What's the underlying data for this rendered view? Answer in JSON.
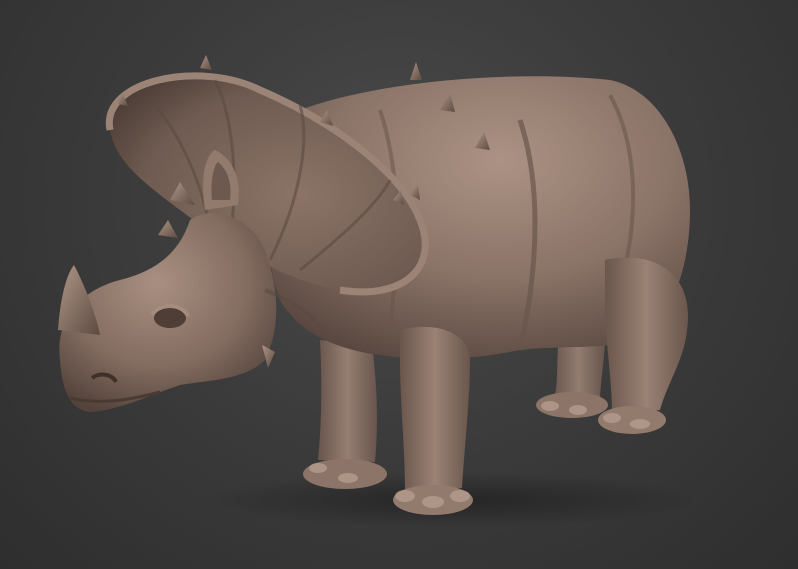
{
  "viewport": {
    "background_color": "#3c3c3c",
    "model": "rhino-triceratops-hybrid-sculpt",
    "material_color": "#8a7468",
    "material_highlight": "#b39a8c",
    "material_shadow": "#4a3a33"
  }
}
